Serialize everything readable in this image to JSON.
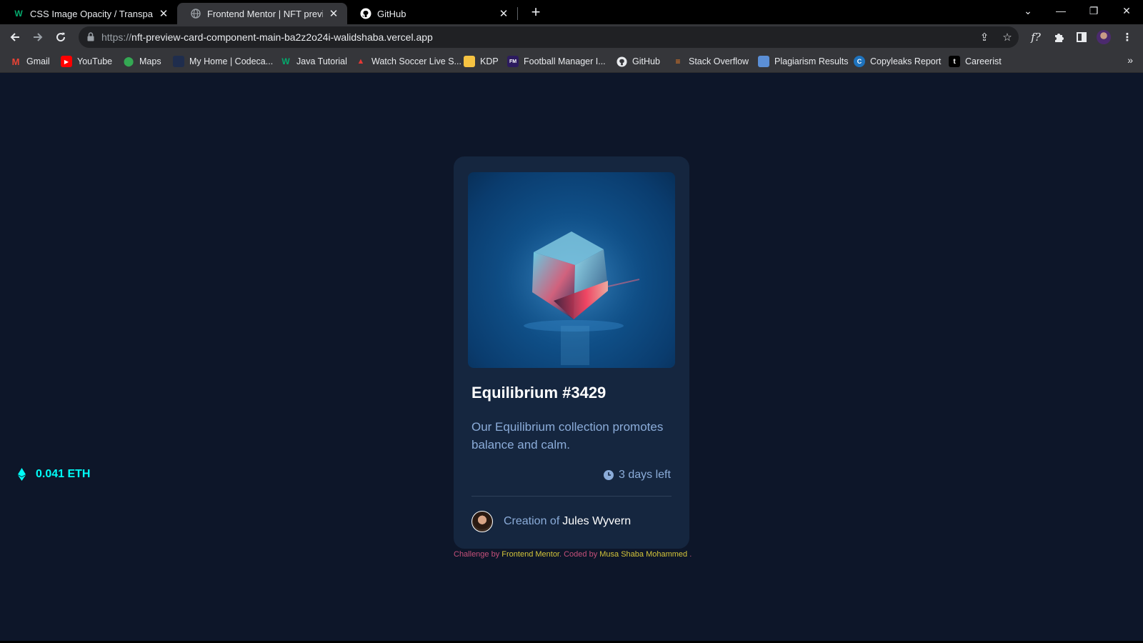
{
  "browser": {
    "tabs": [
      {
        "title": "CSS Image Opacity / Transparency",
        "favicon": "w3schools-icon",
        "active": false
      },
      {
        "title": "Frontend Mentor | NFT preview card",
        "favicon": "globe-icon",
        "active": true
      },
      {
        "title": "GitHub",
        "favicon": "github-icon",
        "active": false
      }
    ],
    "url_scheme": "https://",
    "url_host": "nft-preview-card-component-main-ba2z2o24i-walidshaba.vercel.app",
    "bookmarks": [
      {
        "label": "Gmail",
        "icon": "gmail-icon"
      },
      {
        "label": "YouTube",
        "icon": "youtube-icon"
      },
      {
        "label": "Maps",
        "icon": "maps-icon"
      },
      {
        "label": "My Home | Codeca...",
        "icon": "codecademy-icon"
      },
      {
        "label": "Java Tutorial",
        "icon": "w3schools-icon"
      },
      {
        "label": "Watch Soccer Live S...",
        "icon": "soccer-icon"
      },
      {
        "label": "KDP",
        "icon": "folder-icon"
      },
      {
        "label": "Football Manager I...",
        "icon": "fm-icon"
      },
      {
        "label": "GitHub",
        "icon": "github-icon"
      },
      {
        "label": "Stack Overflow",
        "icon": "stackoverflow-icon"
      },
      {
        "label": "Plagiarism Results",
        "icon": "plagiarism-icon"
      },
      {
        "label": "Copyleaks Report",
        "icon": "copyleaks-icon"
      },
      {
        "label": "Careerist",
        "icon": "careerist-icon"
      }
    ],
    "more_bookmarks": "»"
  },
  "card": {
    "title": "Equilibrium #3429",
    "description": "Our Equilibrium collection promotes balance and calm.",
    "price": "0.041 ETH",
    "time_left": "3 days left",
    "creator_prefix": "Creation of",
    "creator_name": "Jules Wyvern"
  },
  "attribution": {
    "challenge_prefix": "Challenge by",
    "challenge_link": "Frontend Mentor",
    "coded_prefix": ". Coded by",
    "coder_link": "Musa Shaba Mohammed",
    "suffix": "."
  },
  "colors": {
    "page_bg": "#0d1629",
    "card_bg": "#15263f",
    "accent_cyan": "#00fff8",
    "soft_blue": "#8bacd9",
    "attribution_pink": "#c4507a",
    "attribution_link": "#d3c43a"
  }
}
